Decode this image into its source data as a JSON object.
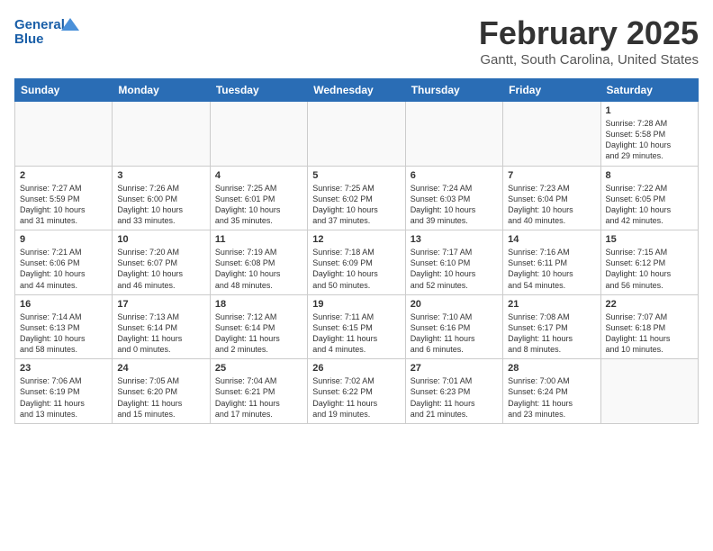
{
  "header": {
    "logo_line1": "General",
    "logo_line2": "Blue",
    "month_title": "February 2025",
    "location": "Gantt, South Carolina, United States"
  },
  "days_of_week": [
    "Sunday",
    "Monday",
    "Tuesday",
    "Wednesday",
    "Thursday",
    "Friday",
    "Saturday"
  ],
  "weeks": [
    [
      {
        "day": "",
        "info": ""
      },
      {
        "day": "",
        "info": ""
      },
      {
        "day": "",
        "info": ""
      },
      {
        "day": "",
        "info": ""
      },
      {
        "day": "",
        "info": ""
      },
      {
        "day": "",
        "info": ""
      },
      {
        "day": "1",
        "info": "Sunrise: 7:28 AM\nSunset: 5:58 PM\nDaylight: 10 hours\nand 29 minutes."
      }
    ],
    [
      {
        "day": "2",
        "info": "Sunrise: 7:27 AM\nSunset: 5:59 PM\nDaylight: 10 hours\nand 31 minutes."
      },
      {
        "day": "3",
        "info": "Sunrise: 7:26 AM\nSunset: 6:00 PM\nDaylight: 10 hours\nand 33 minutes."
      },
      {
        "day": "4",
        "info": "Sunrise: 7:25 AM\nSunset: 6:01 PM\nDaylight: 10 hours\nand 35 minutes."
      },
      {
        "day": "5",
        "info": "Sunrise: 7:25 AM\nSunset: 6:02 PM\nDaylight: 10 hours\nand 37 minutes."
      },
      {
        "day": "6",
        "info": "Sunrise: 7:24 AM\nSunset: 6:03 PM\nDaylight: 10 hours\nand 39 minutes."
      },
      {
        "day": "7",
        "info": "Sunrise: 7:23 AM\nSunset: 6:04 PM\nDaylight: 10 hours\nand 40 minutes."
      },
      {
        "day": "8",
        "info": "Sunrise: 7:22 AM\nSunset: 6:05 PM\nDaylight: 10 hours\nand 42 minutes."
      }
    ],
    [
      {
        "day": "9",
        "info": "Sunrise: 7:21 AM\nSunset: 6:06 PM\nDaylight: 10 hours\nand 44 minutes."
      },
      {
        "day": "10",
        "info": "Sunrise: 7:20 AM\nSunset: 6:07 PM\nDaylight: 10 hours\nand 46 minutes."
      },
      {
        "day": "11",
        "info": "Sunrise: 7:19 AM\nSunset: 6:08 PM\nDaylight: 10 hours\nand 48 minutes."
      },
      {
        "day": "12",
        "info": "Sunrise: 7:18 AM\nSunset: 6:09 PM\nDaylight: 10 hours\nand 50 minutes."
      },
      {
        "day": "13",
        "info": "Sunrise: 7:17 AM\nSunset: 6:10 PM\nDaylight: 10 hours\nand 52 minutes."
      },
      {
        "day": "14",
        "info": "Sunrise: 7:16 AM\nSunset: 6:11 PM\nDaylight: 10 hours\nand 54 minutes."
      },
      {
        "day": "15",
        "info": "Sunrise: 7:15 AM\nSunset: 6:12 PM\nDaylight: 10 hours\nand 56 minutes."
      }
    ],
    [
      {
        "day": "16",
        "info": "Sunrise: 7:14 AM\nSunset: 6:13 PM\nDaylight: 10 hours\nand 58 minutes."
      },
      {
        "day": "17",
        "info": "Sunrise: 7:13 AM\nSunset: 6:14 PM\nDaylight: 11 hours\nand 0 minutes."
      },
      {
        "day": "18",
        "info": "Sunrise: 7:12 AM\nSunset: 6:14 PM\nDaylight: 11 hours\nand 2 minutes."
      },
      {
        "day": "19",
        "info": "Sunrise: 7:11 AM\nSunset: 6:15 PM\nDaylight: 11 hours\nand 4 minutes."
      },
      {
        "day": "20",
        "info": "Sunrise: 7:10 AM\nSunset: 6:16 PM\nDaylight: 11 hours\nand 6 minutes."
      },
      {
        "day": "21",
        "info": "Sunrise: 7:08 AM\nSunset: 6:17 PM\nDaylight: 11 hours\nand 8 minutes."
      },
      {
        "day": "22",
        "info": "Sunrise: 7:07 AM\nSunset: 6:18 PM\nDaylight: 11 hours\nand 10 minutes."
      }
    ],
    [
      {
        "day": "23",
        "info": "Sunrise: 7:06 AM\nSunset: 6:19 PM\nDaylight: 11 hours\nand 13 minutes."
      },
      {
        "day": "24",
        "info": "Sunrise: 7:05 AM\nSunset: 6:20 PM\nDaylight: 11 hours\nand 15 minutes."
      },
      {
        "day": "25",
        "info": "Sunrise: 7:04 AM\nSunset: 6:21 PM\nDaylight: 11 hours\nand 17 minutes."
      },
      {
        "day": "26",
        "info": "Sunrise: 7:02 AM\nSunset: 6:22 PM\nDaylight: 11 hours\nand 19 minutes."
      },
      {
        "day": "27",
        "info": "Sunrise: 7:01 AM\nSunset: 6:23 PM\nDaylight: 11 hours\nand 21 minutes."
      },
      {
        "day": "28",
        "info": "Sunrise: 7:00 AM\nSunset: 6:24 PM\nDaylight: 11 hours\nand 23 minutes."
      },
      {
        "day": "",
        "info": ""
      }
    ]
  ]
}
